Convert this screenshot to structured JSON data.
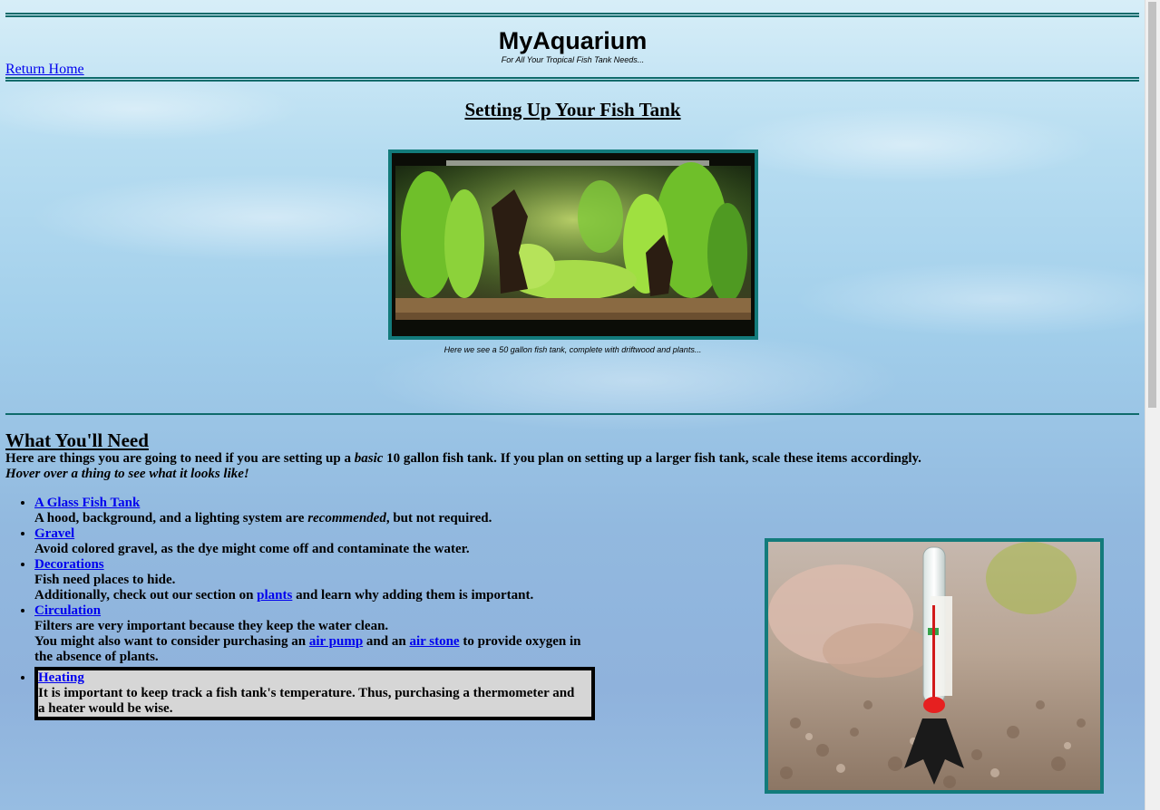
{
  "header": {
    "title": "MyAquarium",
    "tagline": "For All Your Tropical Fish Tank Needs...",
    "home_link": "Return Home"
  },
  "main": {
    "heading": "Setting Up Your Fish Tank",
    "tank_caption": "Here we see a 50 gallon fish tank, complete with driftwood and plants..."
  },
  "needs": {
    "heading": "What You'll Need",
    "intro_before": "Here are things you are going to need if you are setting up a ",
    "intro_emph": "basic",
    "intro_after": " 10 gallon fish tank. If you plan on setting up a larger fish tank, scale these items accordingly.",
    "hover_hint": "Hover over a thing to see what it looks like!",
    "items": [
      {
        "link": "A Glass Fish Tank",
        "desc_before": "A hood, background, and a lighting system are ",
        "desc_emph": "recommended",
        "desc_after": ", but not required."
      },
      {
        "link": "Gravel",
        "desc": "Avoid colored gravel, as the dye might come off and contaminate the water."
      },
      {
        "link": "Decorations",
        "desc": "Fish need places to hide.",
        "desc2_before": "Additionally, check out our section on ",
        "desc2_link": "plants",
        "desc2_after": " and learn why adding them is important."
      },
      {
        "link": "Circulation",
        "desc": "Filters are very important because they keep the water clean.",
        "desc2_before": "You might also want to consider purchasing an ",
        "desc2_link1": "air pump",
        "desc2_mid": " and an ",
        "desc2_link2": "air stone",
        "desc2_after": " to provide oxygen in the absence of plants."
      },
      {
        "link": "Heating",
        "desc": "It is important to keep track a fish tank's temperature. Thus, purchasing a thermometer and a heater would be wise."
      }
    ]
  },
  "colors": {
    "accent_teal": "#137b7b",
    "link_blue": "#0000ee",
    "heating_box_bg": "#d6d6d6"
  }
}
